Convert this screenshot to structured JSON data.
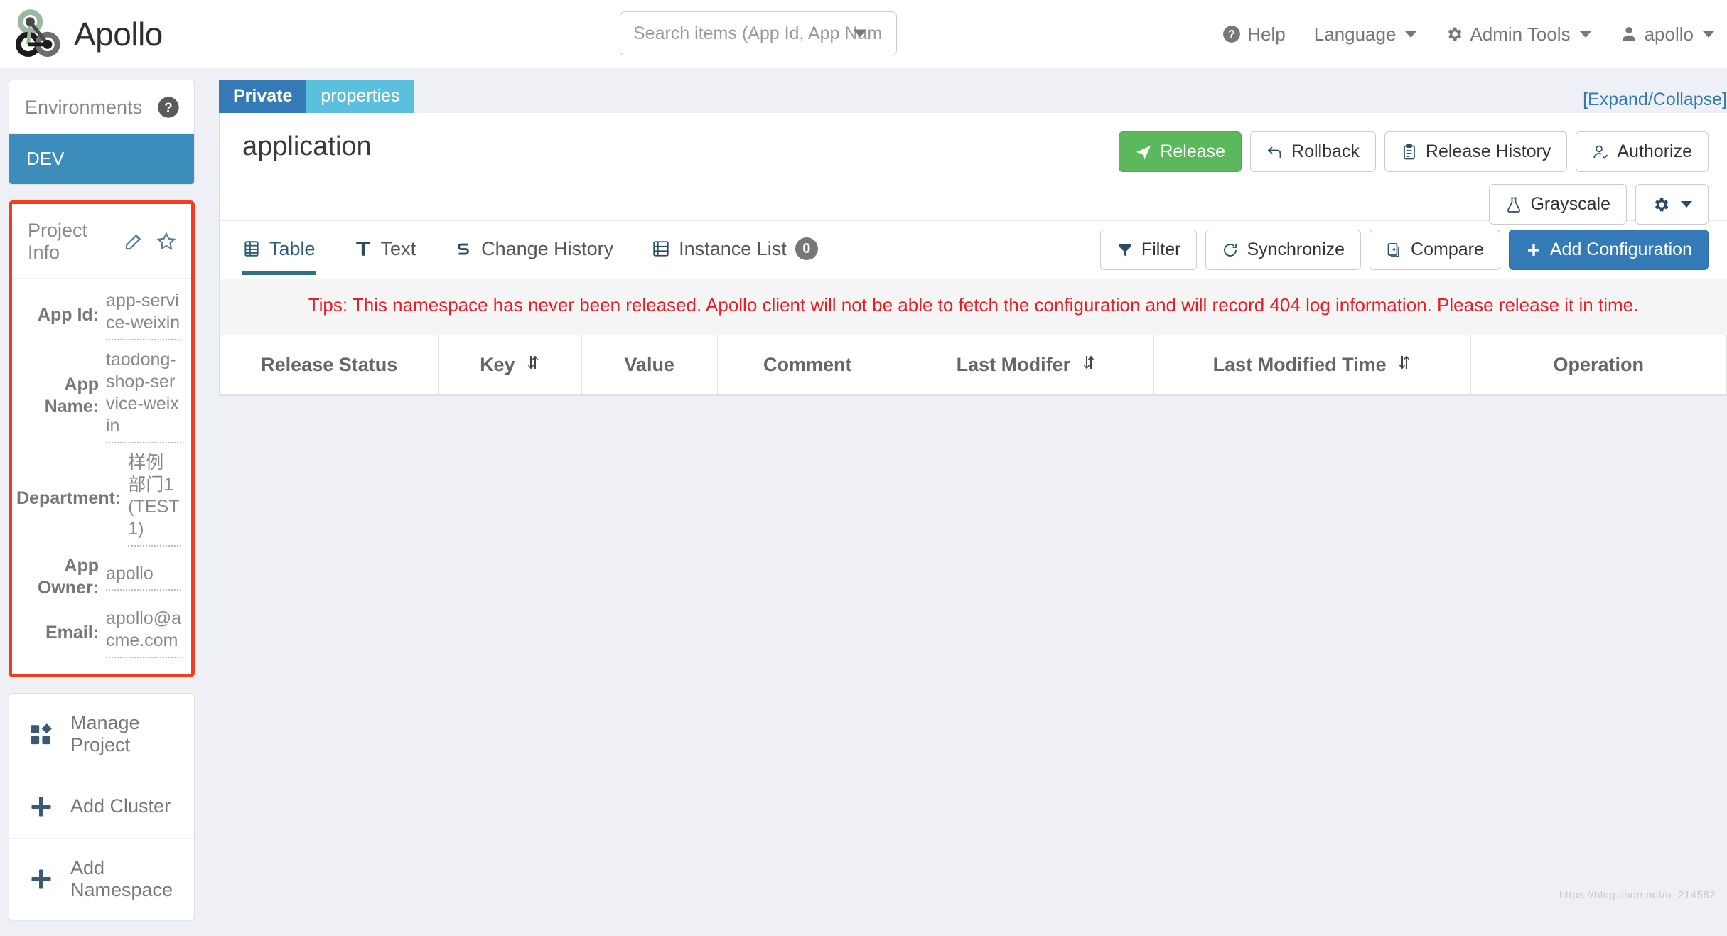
{
  "header": {
    "brand": "Apollo",
    "logo_icon": "apollo-logo",
    "search": {
      "placeholder": "Search items (App Id, App Name)",
      "value": "",
      "caret_icon": "caret-down-icon"
    },
    "nav": [
      {
        "label": "Help",
        "icon": "question-circle-icon",
        "caret": false
      },
      {
        "label": "Language",
        "icon": "",
        "caret": true
      },
      {
        "label": "Admin Tools",
        "icon": "gear-icon",
        "caret": true
      },
      {
        "label": "apollo",
        "icon": "user-icon",
        "caret": true
      }
    ]
  },
  "sidebar": {
    "environments": {
      "title": "Environments",
      "help_icon": "question-circle-icon",
      "items": [
        {
          "label": "DEV",
          "active": true
        }
      ]
    },
    "project_info": {
      "title": "Project Info",
      "edit_icon": "edit-pencil-icon",
      "favorite_icon": "star-icon",
      "highlight_color": "#f63c1e",
      "fields": [
        {
          "label": "App Id:",
          "value": "app-service-weixin"
        },
        {
          "label": "App Name:",
          "value": "taodong-shop-service-weixin"
        },
        {
          "label": "Department:",
          "value": "样例部门1(TEST1)"
        },
        {
          "label": "App Owner:",
          "value": "apollo"
        },
        {
          "label": "Email:",
          "value": "apollo@acme.com"
        }
      ]
    },
    "menu": [
      {
        "label": "Manage Project",
        "icon": "squares-icon"
      },
      {
        "label": "Add Cluster",
        "icon": "plus-icon"
      },
      {
        "label": "Add Namespace",
        "icon": "plus-icon"
      }
    ]
  },
  "main": {
    "badges": [
      {
        "label": "Private",
        "style": "private"
      },
      {
        "label": "properties",
        "style": "properties"
      }
    ],
    "expand_collapse": "[Expand/Collapse]",
    "namespace_title": "application",
    "primary_buttons": [
      {
        "label": "Release",
        "icon": "paper-plane-icon",
        "style": "green"
      },
      {
        "label": "Rollback",
        "icon": "rollback-arrow-icon",
        "style": "default"
      },
      {
        "label": "Release History",
        "icon": "clipboard-list-icon",
        "style": "default"
      },
      {
        "label": "Authorize",
        "icon": "user-check-icon",
        "style": "default"
      }
    ],
    "secondary_buttons": [
      {
        "label": "Grayscale",
        "icon": "flask-icon",
        "style": "default"
      },
      {
        "label": "",
        "icon": "gear-icon",
        "style": "default",
        "caret": true
      }
    ],
    "tabs": [
      {
        "label": "Table",
        "icon": "table-icon",
        "active": true,
        "badge": ""
      },
      {
        "label": "Text",
        "icon": "text-t-icon",
        "active": false,
        "badge": ""
      },
      {
        "label": "Change History",
        "icon": "history-s-icon",
        "active": false,
        "badge": ""
      },
      {
        "label": "Instance List",
        "icon": "server-list-icon",
        "active": false,
        "badge": "0"
      }
    ],
    "tab_actions": [
      {
        "label": "Filter",
        "icon": "filter-icon",
        "style": "default"
      },
      {
        "label": "Synchronize",
        "icon": "sync-icon",
        "style": "default"
      },
      {
        "label": "Compare",
        "icon": "compare-doc-icon",
        "style": "default"
      },
      {
        "label": "Add Configuration",
        "icon": "plus-icon",
        "style": "blue"
      }
    ],
    "tips": "Tips: This namespace has never been released. Apollo client will not be able to fetch the configuration and will record 404 log information. Please release it in time.",
    "table": {
      "columns": [
        {
          "label": "Release Status",
          "sortable": false
        },
        {
          "label": "Key",
          "sortable": true
        },
        {
          "label": "Value",
          "sortable": false
        },
        {
          "label": "Comment",
          "sortable": false
        },
        {
          "label": "Last Modifer",
          "sortable": true
        },
        {
          "label": "Last Modified Time",
          "sortable": true
        },
        {
          "label": "Operation",
          "sortable": false
        }
      ],
      "rows": []
    }
  },
  "watermark": "https://blog.csdn.net/u_214582"
}
